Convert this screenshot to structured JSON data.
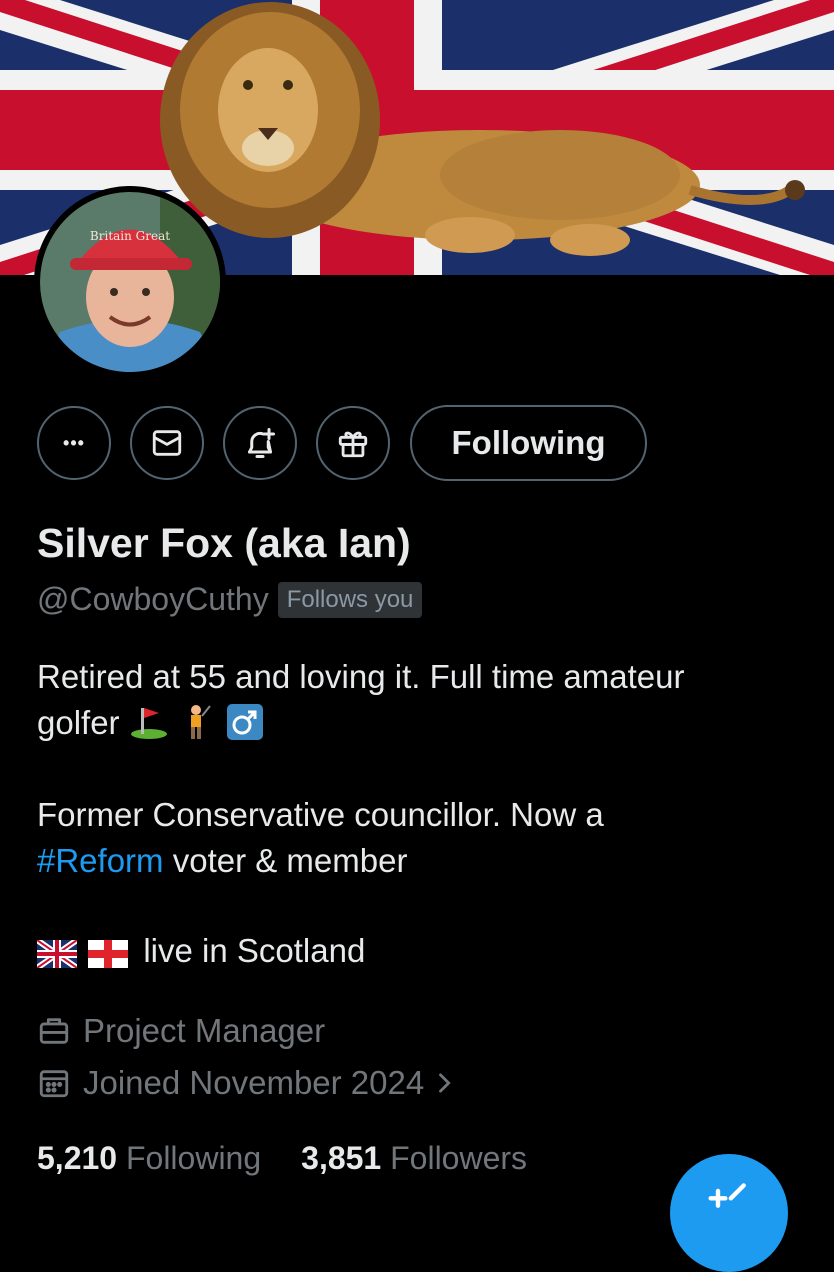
{
  "profile": {
    "display_name": "Silver Fox (aka Ian)",
    "handle": "@CowboyCuthy",
    "follows_you_badge": "Follows you",
    "bio_line1_a": "Retired at 55 and loving it. Full time amateur",
    "bio_line1_b": "golfer",
    "bio_line2_a": "Former Conservative councillor. Now a",
    "bio_hashtag": "#Reform",
    "bio_line2_b": " voter & member",
    "bio_line3": "live in Scotland",
    "job": "Project Manager",
    "joined": "Joined November 2024",
    "cap_text": "Britain Great"
  },
  "actions": {
    "more_label": "•••",
    "following_button": "Following"
  },
  "stats": {
    "following_count": "5,210",
    "following_label": "Following",
    "followers_count": "3,851",
    "followers_label": "Followers"
  },
  "icons": [
    "more-icon",
    "message-icon",
    "notify-icon",
    "gift-icon",
    "briefcase-icon",
    "calendar-icon",
    "chevron-right-icon",
    "compose-icon"
  ],
  "colors": {
    "accent": "#1d9bf0",
    "background": "#000000",
    "muted": "#71767b"
  }
}
